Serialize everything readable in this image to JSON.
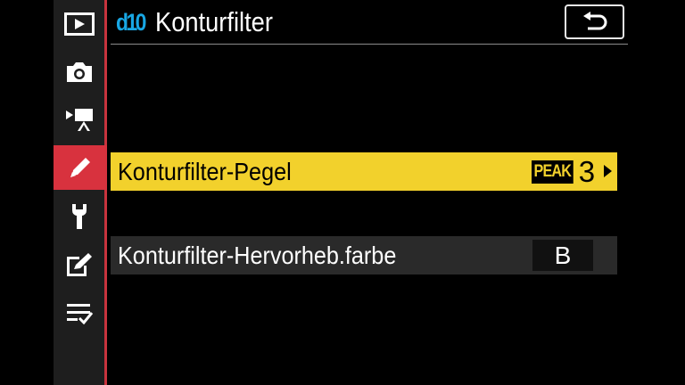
{
  "sidebar": {
    "items": [
      {
        "icon": "playback-icon"
      },
      {
        "icon": "camera-icon"
      },
      {
        "icon": "movie-camera-icon"
      },
      {
        "icon": "pencil-icon",
        "active": true
      },
      {
        "icon": "wrench-icon"
      },
      {
        "icon": "retouch-icon"
      },
      {
        "icon": "my-menu-icon"
      }
    ],
    "active_color": "#d8323e"
  },
  "header": {
    "badge": "d10",
    "title": "Konturfilter",
    "back_icon": "return-arrow-icon"
  },
  "menu": {
    "rows": [
      {
        "label": "Konturfilter-Pegel",
        "badge": "PEAK",
        "value": "3",
        "selected": true
      },
      {
        "label": "Konturfilter-Hervorheb.farbe",
        "value": "B",
        "selected": false
      }
    ]
  },
  "colors": {
    "highlight": "#f2d12c",
    "accent": "#18a7e4"
  }
}
